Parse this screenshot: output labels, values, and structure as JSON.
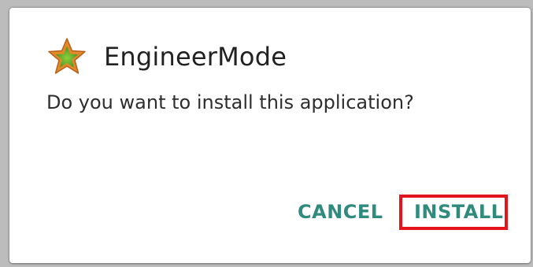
{
  "dialog": {
    "app_name": "EngineerMode",
    "app_icon": "star-icon",
    "message": "Do you want to install this application?",
    "cancel_label": "CANCEL",
    "install_label": "INSTALL",
    "button_color": "#2e8b7d",
    "highlight_color": "#e3141c"
  }
}
